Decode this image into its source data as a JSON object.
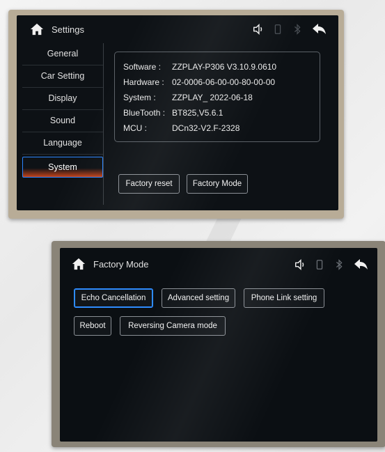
{
  "screen1": {
    "title": "Settings",
    "sidebar": [
      {
        "label": "General"
      },
      {
        "label": "Car Setting"
      },
      {
        "label": "Display"
      },
      {
        "label": "Sound"
      },
      {
        "label": "Language"
      },
      {
        "label": "System",
        "active": true
      }
    ],
    "info": [
      {
        "key": "Software :",
        "value": "ZZPLAY-P306 V3.10.9.0610"
      },
      {
        "key": "Hardware :",
        "value": "02-0006-06-00-00-80-00-00"
      },
      {
        "key": "System :",
        "value": "ZZPLAY_ 2022-06-18"
      },
      {
        "key": "BlueTooth :",
        "value": "BT825,V5.6.1"
      },
      {
        "key": "MCU :",
        "value": "DCn32-V2.F-2328"
      }
    ],
    "buttons": {
      "factory_reset": "Factory reset",
      "factory_mode": "Factory Mode"
    },
    "icons": [
      "home-icon",
      "volume-icon",
      "phone-icon",
      "bluetooth-icon",
      "back-arrow-icon"
    ]
  },
  "screen2": {
    "title": "Factory Mode",
    "buttons": {
      "echo": "Echo Cancellation",
      "advanced": "Advanced setting",
      "phone_link": "Phone Link setting",
      "reboot": "Reboot",
      "reversing": "Reversing Camera mode"
    },
    "icons": [
      "home-icon",
      "volume-icon",
      "phone-icon",
      "bluetooth-icon",
      "back-arrow-icon"
    ]
  },
  "colors": {
    "screen_bg": "#0d1115",
    "focus_blue": "#2b85ff",
    "active_orange": "#c2431a",
    "button_border": "#8b9096"
  }
}
